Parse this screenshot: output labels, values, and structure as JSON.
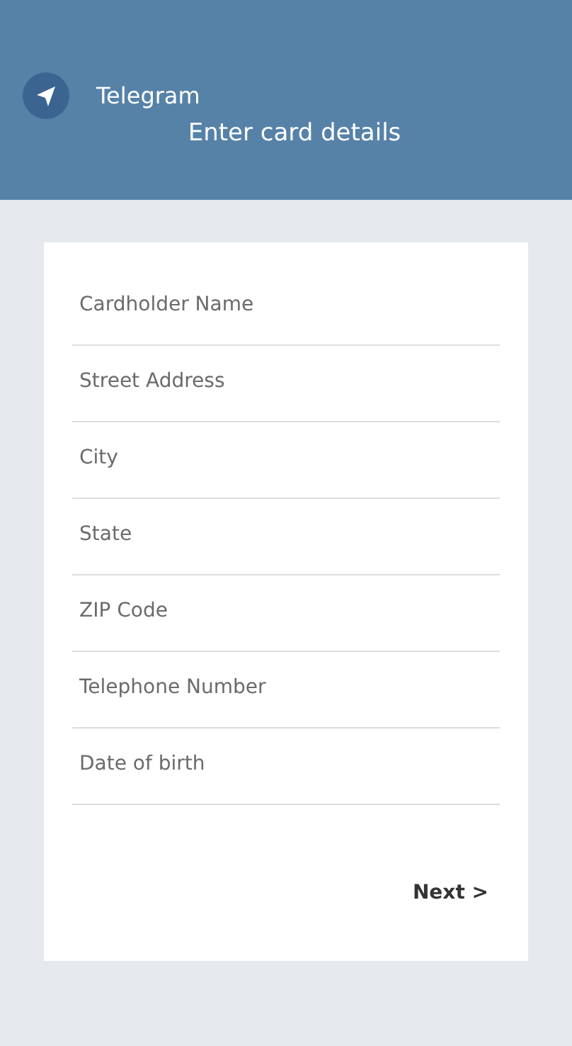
{
  "header": {
    "app_name": "Telegram",
    "title": "Enter card details"
  },
  "fields": [
    {
      "placeholder": "Cardholder Name"
    },
    {
      "placeholder": "Street Address"
    },
    {
      "placeholder": "City"
    },
    {
      "placeholder": "State"
    },
    {
      "placeholder": "ZIP Code"
    },
    {
      "placeholder": "Telephone Number"
    },
    {
      "placeholder": "Date of birth"
    }
  ],
  "next_button": "Next >"
}
